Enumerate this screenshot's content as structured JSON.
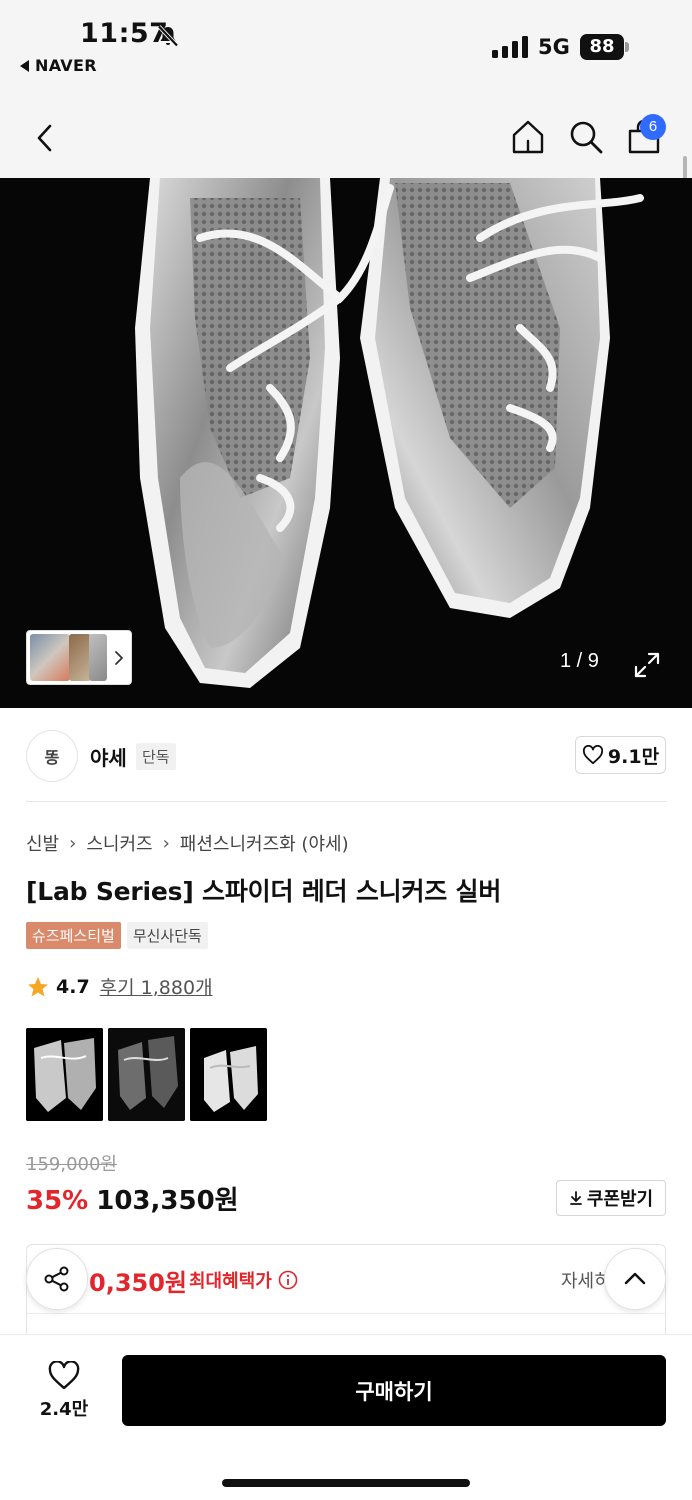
{
  "status_bar": {
    "time": "11:57",
    "back_app": "NAVER",
    "network": "5G",
    "battery": "88"
  },
  "header": {
    "cart_count": "6"
  },
  "gallery": {
    "counter": "1 / 9"
  },
  "shop": {
    "logo_text": "똥",
    "name": "야세",
    "tag": "단독",
    "likes": "9.1만"
  },
  "breadcrumb": [
    "신발",
    "스니커즈",
    "패션스니커즈화 (야세)"
  ],
  "product": {
    "title": "[Lab Series] 스파이더 레더 스니커즈 실버",
    "tags": [
      "슈즈페스티벌",
      "무신사단독"
    ],
    "rating": "4.7",
    "reviews": "후기 1,880개",
    "original_price": "159,000원",
    "discount": "35%",
    "price": "103,350원",
    "coupon_label": "쿠폰받기"
  },
  "benefit": {
    "price": "0,350원",
    "label": "최대혜택가",
    "detail": "자세히"
  },
  "bottom_bar": {
    "wish_count": "2.4만",
    "buy_label": "구매하기"
  },
  "colors": {
    "discount_red": "#e3262c",
    "badge_blue": "#2f6bff",
    "tag_orange": "#d98a6b"
  }
}
